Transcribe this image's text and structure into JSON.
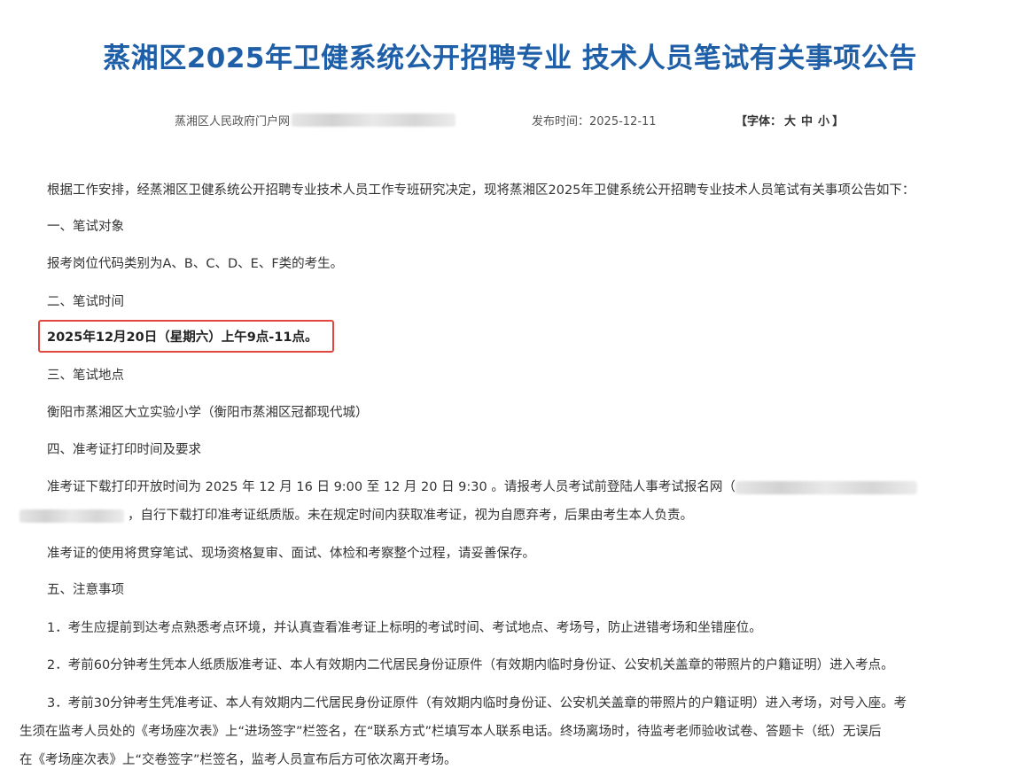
{
  "title": "蒸湘区2025年卫健系统公开招聘专业 技术人员笔试有关事项公告",
  "meta": {
    "source": "蒸湘区人民政府门户网",
    "publish_time": "发布时间：2025-12-11",
    "font_label_open": "【字体：",
    "font_large": "大",
    "font_medium": "中",
    "font_small": "小",
    "font_label_close": "】"
  },
  "body": {
    "intro": "根据工作安排，经蒸湘区卫健系统公开招聘专业技术人员工作专班研究决定，现将蒸湘区2025年卫健系统公开招聘专业技术人员笔试有关事项公告如下：",
    "s1_title": "一、笔试对象",
    "s1_text": "报考岗位代码类别为A、B、C、D、E、F类的考生。",
    "s2_title": "二、笔试时间",
    "s2_text": "2025年12月20日（星期六）上午9点-11点。",
    "s3_title": "三、笔试地点",
    "s3_text": "衡阳市蒸湘区大立实验小学（衡阳市蒸湘区冠都现代城）",
    "s4_title": "四、准考证打印时间及要求",
    "s4_text1": "准考证下载打印开放时间为 2025 年 12 月 16 日 9:00 至 12 月 20 日 9:30 。请报考人员考试前登陆人事考试报名网（",
    "s4_text2": "，自行下载打印准考证纸质版。未在规定时间内获取准考证，视为自愿弃考，后果由考生本人负责。",
    "s4_text3": "准考证的使用将贯穿笔试、现场资格复审、面试、体检和考察整个过程，请妥善保存。",
    "s5_title": "五、注意事项",
    "s5_item1": "1．考生应提前到达考点熟悉考点环境，并认真查看准考证上标明的考试时间、考试地点、考场号，防止进错考场和坐错座位。",
    "s5_item2": "2．考前60分钟考生凭本人纸质版准考证、本人有效期内二代居民身份证原件（有效期内临时身份证、公安机关盖章的带照片的户籍证明）进入考点。",
    "s5_item3_l1": "3．考前30分钟考生凭准考证、本人有效期内二代居民身份证原件（有效期内临时身份证、公安机关盖章的带照片的户籍证明）进入考场，对号入座。考",
    "s5_item3_l2": "生须在监考人员处的《考场座次表》上“进场签字”栏签名，在“联系方式”栏填写本人联系电话。终场离场时，待监考老师验收试卷、答题卡（纸）无误后",
    "s5_item3_l3": "在《考场座次表》上“交卷签字”栏签名，监考人员宣布后方可依次离开考场。"
  },
  "colors": {
    "title": "#1f5fa8",
    "highlight_border": "#e0473f"
  }
}
